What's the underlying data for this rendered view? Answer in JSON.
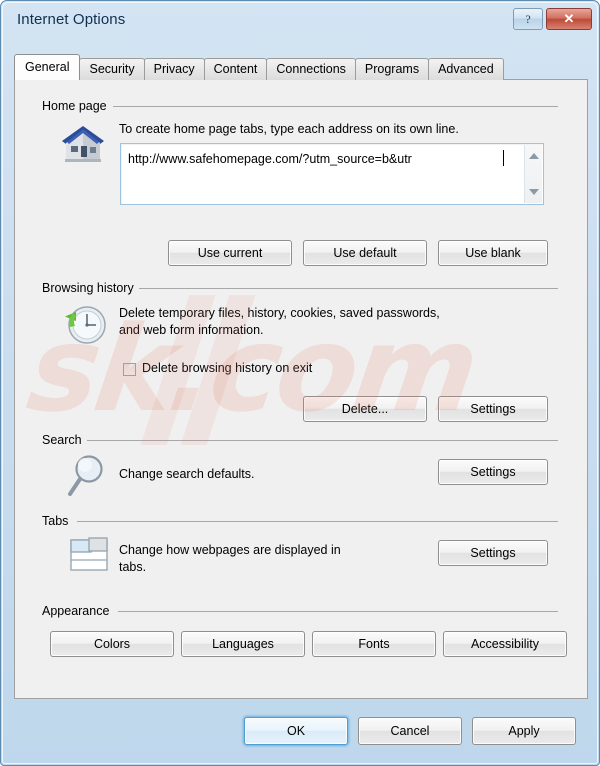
{
  "window": {
    "title": "Internet Options",
    "help_button": "?",
    "close_button": "✕",
    "frame_color": "#5a8cb4",
    "titlebar_color": "#d3e4f3",
    "close_button_color": "#be4a37"
  },
  "tabs": [
    {
      "label": "General",
      "active": true
    },
    {
      "label": "Security",
      "active": false
    },
    {
      "label": "Privacy",
      "active": false
    },
    {
      "label": "Content",
      "active": false
    },
    {
      "label": "Connections",
      "active": false
    },
    {
      "label": "Programs",
      "active": false
    },
    {
      "label": "Advanced",
      "active": false
    }
  ],
  "home_page": {
    "group_label": "Home page",
    "icon": "house-icon",
    "description": "To create home page tabs, type each address on its own line.",
    "url_value": "http://www.safehomepage.com/?utm_source=b&utr",
    "buttons": [
      {
        "label": "Use current"
      },
      {
        "label": "Use default"
      },
      {
        "label": "Use blank"
      }
    ]
  },
  "browsing_history": {
    "group_label": "Browsing history",
    "icon": "history-clock-icon",
    "description_line1": "Delete temporary files, history, cookies, saved passwords,",
    "description_line2": "and web form information.",
    "checkbox_label": "Delete browsing history on exit",
    "checkbox_checked": false,
    "buttons": [
      {
        "label": "Delete..."
      },
      {
        "label": "Settings"
      }
    ]
  },
  "search": {
    "group_label": "Search",
    "icon": "magnifier-icon",
    "description": "Change search defaults.",
    "settings_button": "Settings"
  },
  "tabs_section": {
    "group_label": "Tabs",
    "icon": "tabs-icon",
    "description_line1": "Change how webpages are displayed in",
    "description_line2": "tabs.",
    "settings_button": "Settings"
  },
  "appearance": {
    "group_label": "Appearance",
    "buttons": [
      {
        "label": "Colors"
      },
      {
        "label": "Languages"
      },
      {
        "label": "Fonts"
      },
      {
        "label": "Accessibility"
      }
    ]
  },
  "dialog_buttons": {
    "ok": "OK",
    "cancel": "Cancel",
    "apply": "Apply",
    "default_button": "OK"
  },
  "watermark": {
    "text": "sk.com"
  }
}
